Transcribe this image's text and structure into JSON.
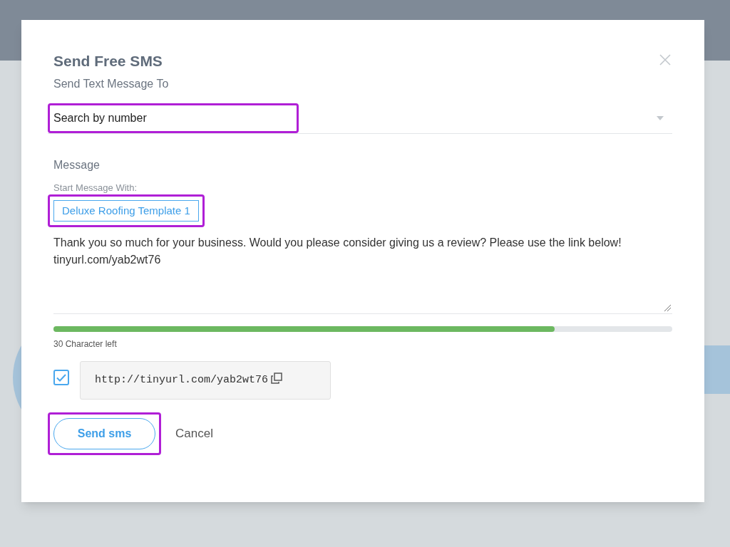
{
  "dialog": {
    "title": "Send Free SMS",
    "subtitle": "Send Text Message To"
  },
  "recipient": {
    "value": "Search by number",
    "highlighted": true
  },
  "message_label": "Message",
  "template_label": "Start Message With:",
  "template": {
    "label": "Deluxe Roofing Template 1",
    "highlighted": true
  },
  "message_lines": [
    "Thank you so much for your business. Would you please consider giving us a review? Please use the link below!",
    "tinyurl.com/yab2wt76"
  ],
  "progress": {
    "level": 0.81,
    "reading": "30 Character left"
  },
  "link": {
    "checked": true,
    "url": "http://tinyurl.com/yab2wt76"
  },
  "send_button": {
    "label": "Send sms",
    "highlighted": true
  },
  "cancel": "Cancel"
}
